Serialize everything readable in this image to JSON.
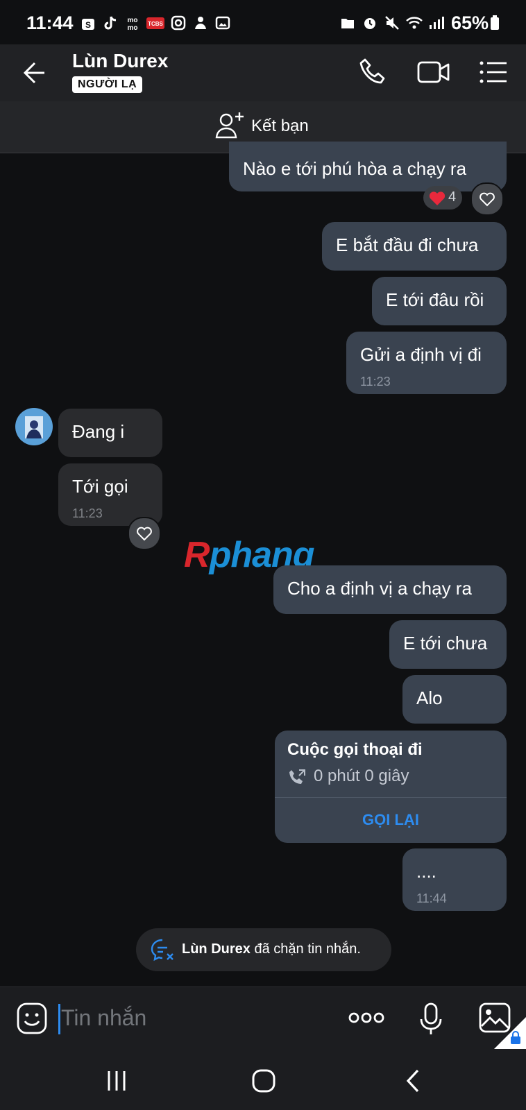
{
  "status_bar": {
    "time": "11:44",
    "battery": "65%"
  },
  "header": {
    "contact_name": "Lùn Durex",
    "badge": "NGƯỜI LẠ"
  },
  "friend_bar": {
    "label": "Kết bạn"
  },
  "messages": [
    {
      "text": "Nào e tới phú hòa a chạy ra",
      "reaction_count": "4"
    },
    {
      "text": "E bắt đầu đi chưa"
    },
    {
      "text": "E tới đâu rồi"
    },
    {
      "text": "Gửi a định vị đi",
      "time": "11:23"
    },
    {
      "text": "Đang i"
    },
    {
      "text": "Tới gọi",
      "time": "11:23"
    },
    {
      "text": "Cho a định vị a chạy ra"
    },
    {
      "text": "E tới chưa"
    },
    {
      "text": "Alo"
    },
    {
      "text": "....",
      "time": "11:44"
    }
  ],
  "watermark": {
    "part1": "R",
    "part2": "phang"
  },
  "call_card": {
    "title": "Cuộc gọi thoại đi",
    "duration": "0 phút 0 giây",
    "action": "GỌI LẠI"
  },
  "blocked_notice": {
    "name": "Lùn Durex",
    "text": " đã chặn tin nhắn."
  },
  "composer": {
    "placeholder": "Tin nhắn"
  },
  "colors": {
    "sent_bubble": "#3a4350",
    "received_bubble": "#2a2b2e",
    "accent": "#2d8cf0",
    "background": "#0f1012"
  }
}
